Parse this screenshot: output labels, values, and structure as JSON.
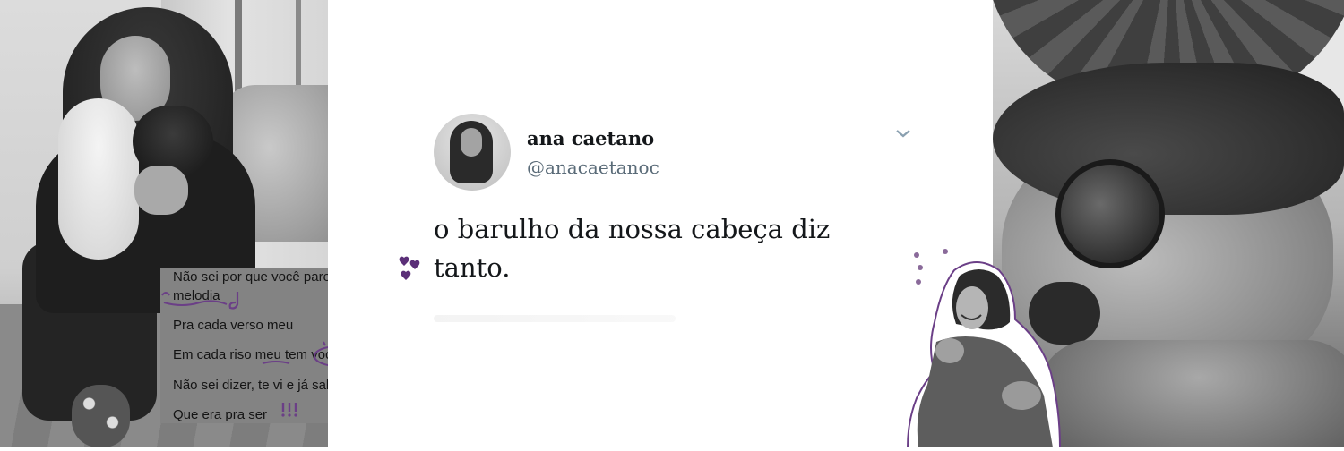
{
  "lyrics": {
    "lines": [
      "Não sei por que você parece",
      "melodia",
      "Pra cada verso meu",
      "Em cada riso meu tem você",
      "Não sei dizer, te vi e já sabia",
      "Que era pra ser"
    ]
  },
  "tweet": {
    "display_name": "ana caetano",
    "handle": "@anacaetanoc",
    "text_line1": "o barulho da nossa cabeça diz",
    "text_line2": "tanto."
  },
  "colors": {
    "accent_purple": "#6b3f87",
    "lyrics_bg": "#838383"
  },
  "icons": [
    "chevron-down-icon",
    "heart-doodle-icon",
    "music-note-doodle-icon"
  ]
}
